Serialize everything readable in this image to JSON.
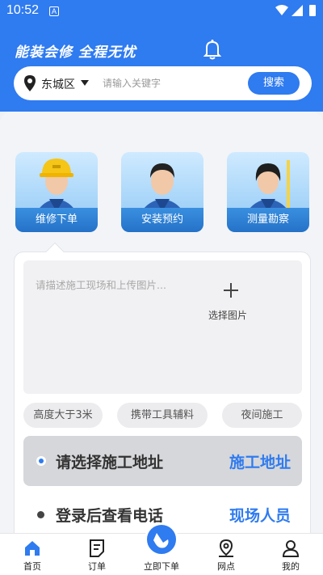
{
  "status_bar": {
    "time": "10:52",
    "notification_letter": "A"
  },
  "header": {
    "slogan": "能装会修 全程无忧",
    "location": "东城区",
    "search_placeholder": "请输入关键字",
    "search_button": "搜索"
  },
  "services": [
    {
      "label": "维修下单"
    },
    {
      "label": "安装预约"
    },
    {
      "label": "测量勘察"
    }
  ],
  "order_form": {
    "description_placeholder": "请描述施工现场和上传图片...",
    "choose_image": "选择图片",
    "tags": [
      "高度大于3米",
      "携带工具辅料",
      "夜间施工"
    ],
    "address_row": {
      "label": "请选择施工地址",
      "link": "施工地址"
    },
    "phone_row": {
      "label": "登录后查看电话",
      "link": "现场人员"
    }
  },
  "tabbar": {
    "items": [
      {
        "label": "首页"
      },
      {
        "label": "订单"
      },
      {
        "label": "立即下单"
      },
      {
        "label": "网点"
      },
      {
        "label": "我的"
      }
    ]
  },
  "colors": {
    "accent": "#2f7bf0",
    "tag_bg": "#ececee",
    "selected_row_bg": "#d6d7da"
  }
}
